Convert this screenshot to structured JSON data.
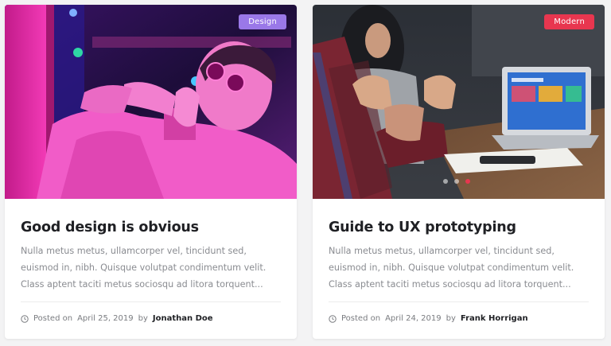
{
  "cards": [
    {
      "badge": "Design",
      "badge_color": "#9a78e8",
      "title": "Good design is obvious",
      "excerpt": "Nulla metus metus, ullamcorper vel, tincidunt sed, euismod in, nibh. Quisque volutpat condimentum velit. Class aptent taciti metus sociosqu ad litora torquent...",
      "posted_label": "Posted on",
      "date": "April 25, 2019",
      "by_label": "by",
      "author": "Jonathan Doe",
      "image_icon": "portrait-photo"
    },
    {
      "badge": "Modern",
      "badge_color": "#e8364f",
      "title": "Guide to UX prototyping",
      "excerpt": "Nulla metus metus, ullamcorper vel, tincidunt sed, euismod in, nibh. Quisque volutpat condimentum velit. Class aptent taciti metus sociosqu ad litora torquent...",
      "posted_label": "Posted on",
      "date": "April 24, 2019",
      "by_label": "by",
      "author": "Frank Horrigan",
      "image_icon": "meeting-laptop-photo",
      "slider_dots": 3,
      "slider_active": 2
    }
  ]
}
